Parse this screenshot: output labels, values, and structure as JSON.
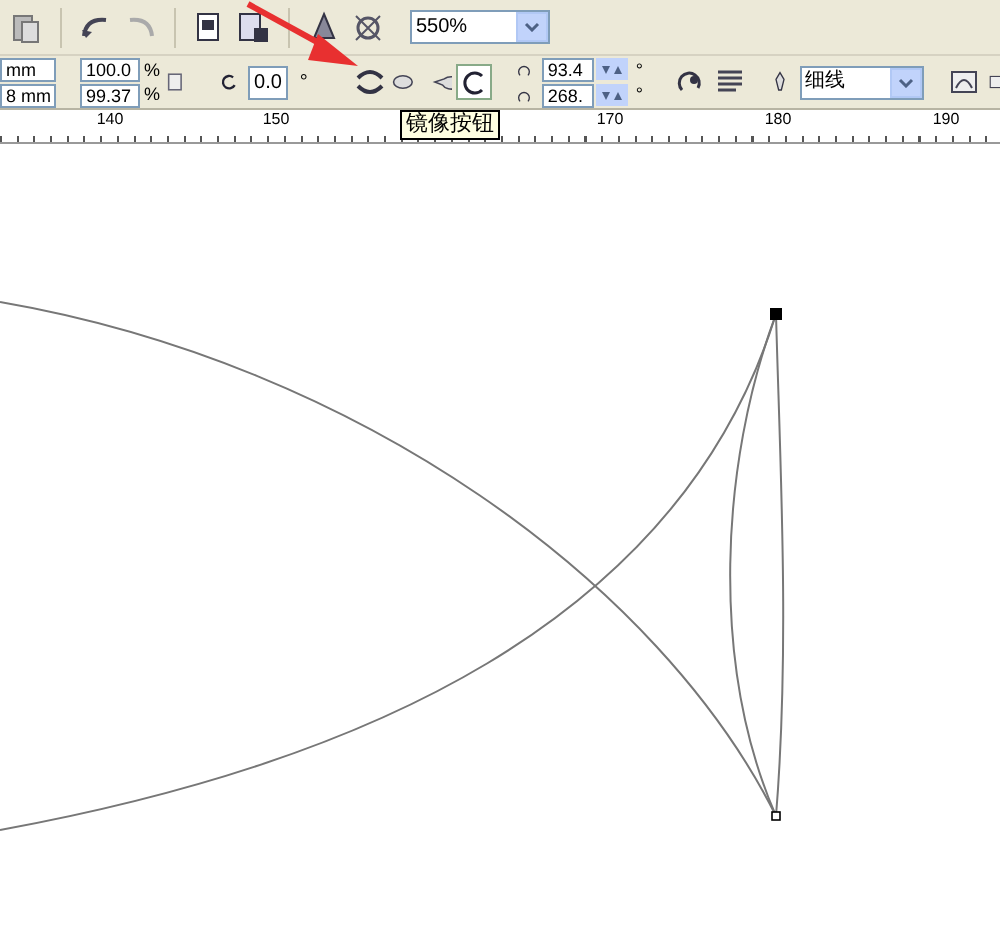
{
  "standard_toolbar": {
    "zoom_level": "550%"
  },
  "property_bar": {
    "size_fields": [
      "mm",
      "8 mm"
    ],
    "scale_fields": [
      "100.0",
      "99.37"
    ],
    "scale_units": [
      "%",
      "%"
    ],
    "rotation": "0.0",
    "rotation_unit": "°",
    "angle_fields": [
      "93.4",
      "268."
    ],
    "angle_units": [
      "°",
      "°"
    ],
    "outline_width": "细线"
  },
  "tooltip": "镜像按钮",
  "ruler": {
    "labels": [
      "140",
      "150",
      "170",
      "180",
      "190"
    ]
  }
}
